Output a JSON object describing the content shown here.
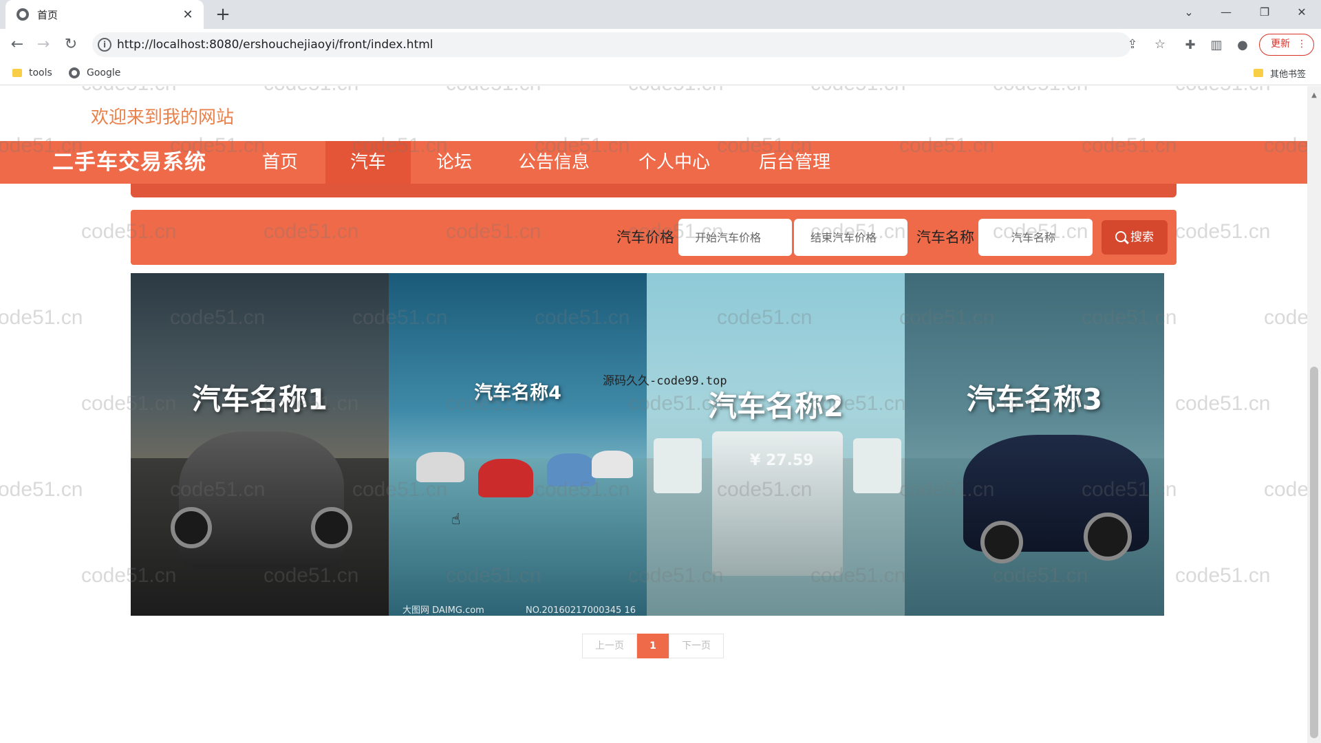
{
  "browser": {
    "tab_title": "首页",
    "tab_close": "✕",
    "new_tab": "+",
    "url": "http://localhost:8080/ershouchejiaoyi/front/index.html",
    "update_label": "更新",
    "bookmarks": [
      {
        "label": "tools"
      },
      {
        "label": "Google"
      }
    ],
    "other_bookmarks": "其他书签"
  },
  "site": {
    "welcome": "欢迎来到我的网站",
    "brand": "二手车交易系统",
    "nav": [
      "首页",
      "汽车",
      "论坛",
      "公告信息",
      "个人中心",
      "后台管理"
    ],
    "active_nav": "汽车"
  },
  "search": {
    "price_label": "汽车价格",
    "price_start_placeholder": "开始汽车价格",
    "price_end_placeholder": "结束汽车价格",
    "name_label": "汽车名称",
    "name_placeholder": "汽车名称",
    "button": "搜索"
  },
  "cars": [
    {
      "title": "汽车名称1"
    },
    {
      "title": "汽车名称4",
      "stamp_left": "大图网 DAIMG.com",
      "stamp_right": "NO.20160217000345 16"
    },
    {
      "title": "汽车名称2",
      "price_text": "¥ 27.59"
    },
    {
      "title": "汽车名称3"
    }
  ],
  "overlay_text": "源码久久-code99.top",
  "pagination": {
    "prev": "上一页",
    "current": "1",
    "next": "下一页"
  },
  "watermark": "code51.cn",
  "colors": {
    "primary": "#ef6a48",
    "primary_dark": "#e35536",
    "welcome": "#e8814b"
  }
}
